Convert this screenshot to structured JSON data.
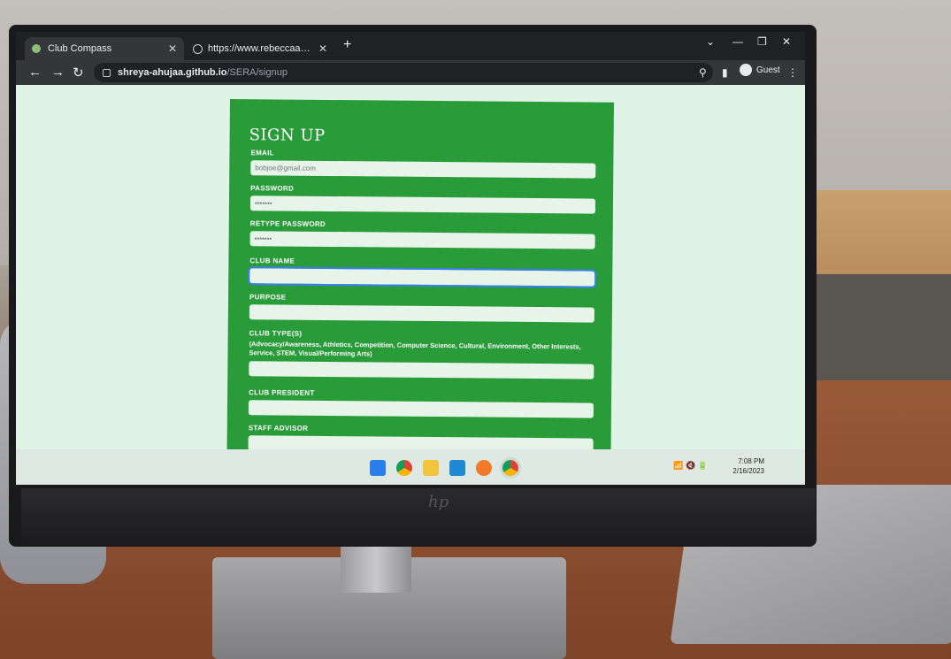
{
  "browser": {
    "tabs": [
      {
        "title": "Club Compass",
        "active": true
      },
      {
        "title": "https://www.rebeccaaa.tk/api/clu",
        "active": false
      }
    ],
    "url_host": "shreya-ahujaa.github.io",
    "url_path": "/SERA/signup",
    "profile_label": "Guest"
  },
  "form": {
    "heading": "SIGN UP",
    "fields": [
      {
        "label": "EMAIL",
        "value": "",
        "placeholder": "bobjoe@gmail.com"
      },
      {
        "label": "PASSWORD",
        "value": "•••••••",
        "placeholder": ""
      },
      {
        "label": "RETYPE PASSWORD",
        "value": "•••••••",
        "placeholder": ""
      },
      {
        "label": "CLUB NAME",
        "value": "",
        "placeholder": "",
        "focused": true
      },
      {
        "label": "PURPOSE",
        "value": "",
        "placeholder": ""
      },
      {
        "label": "CLUB TYPE(S)",
        "help": "(Advocacy/Awareness, Athletics, Competition, Computer Science, Cultural, Environment, Other Interests, Service, STEM, Visual/Performing Arts)",
        "value": "",
        "placeholder": ""
      },
      {
        "label": "CLUB PRESIDENT",
        "value": "",
        "placeholder": ""
      },
      {
        "label": "STAFF ADVISOR",
        "value": "",
        "placeholder": ""
      }
    ]
  },
  "taskbar": {
    "time": "7:08 PM",
    "date": "2/16/2023",
    "apps": [
      "windows-start",
      "chrome",
      "file-explorer",
      "vscode",
      "app-orange",
      "chrome-active"
    ]
  },
  "colors": {
    "card_green": "#2a9b39",
    "page_bg": "#dff3e6",
    "chrome_dark": "#202124"
  }
}
